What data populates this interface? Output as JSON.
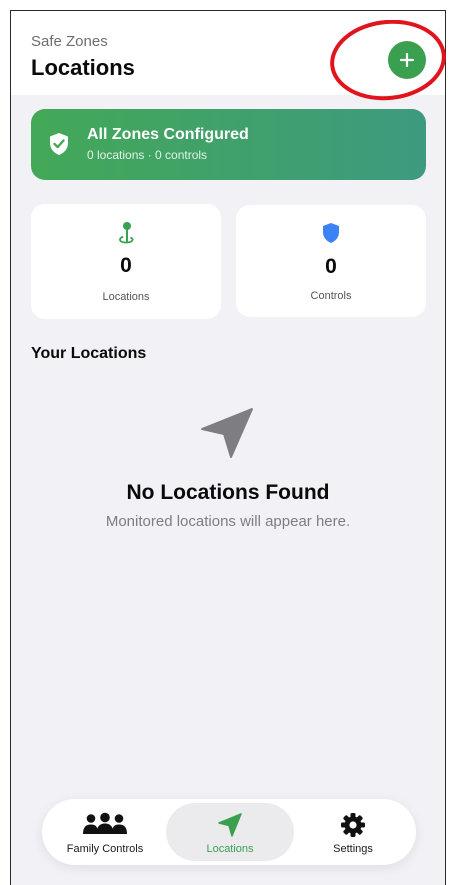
{
  "header": {
    "subtitle": "Safe Zones",
    "title": "Locations"
  },
  "banner": {
    "title": "All Zones Configured",
    "subtitle": "0 locations · 0 controls"
  },
  "stats": [
    {
      "value": "0",
      "label": "Locations",
      "icon": "map-pin-icon"
    },
    {
      "value": "0",
      "label": "Controls",
      "icon": "shield-icon"
    }
  ],
  "section": {
    "title": "Your Locations"
  },
  "empty": {
    "title": "No Locations Found",
    "subtitle": "Monitored locations will appear here."
  },
  "tabs": [
    {
      "label": "Family Controls",
      "icon": "people-icon"
    },
    {
      "label": "Locations",
      "icon": "location-arrow-icon",
      "selected": true
    },
    {
      "label": "Settings",
      "icon": "gear-icon"
    }
  ],
  "colors": {
    "accent": "#3b9f50",
    "shield": "#3b82f6",
    "annotation": "#e0141c"
  }
}
